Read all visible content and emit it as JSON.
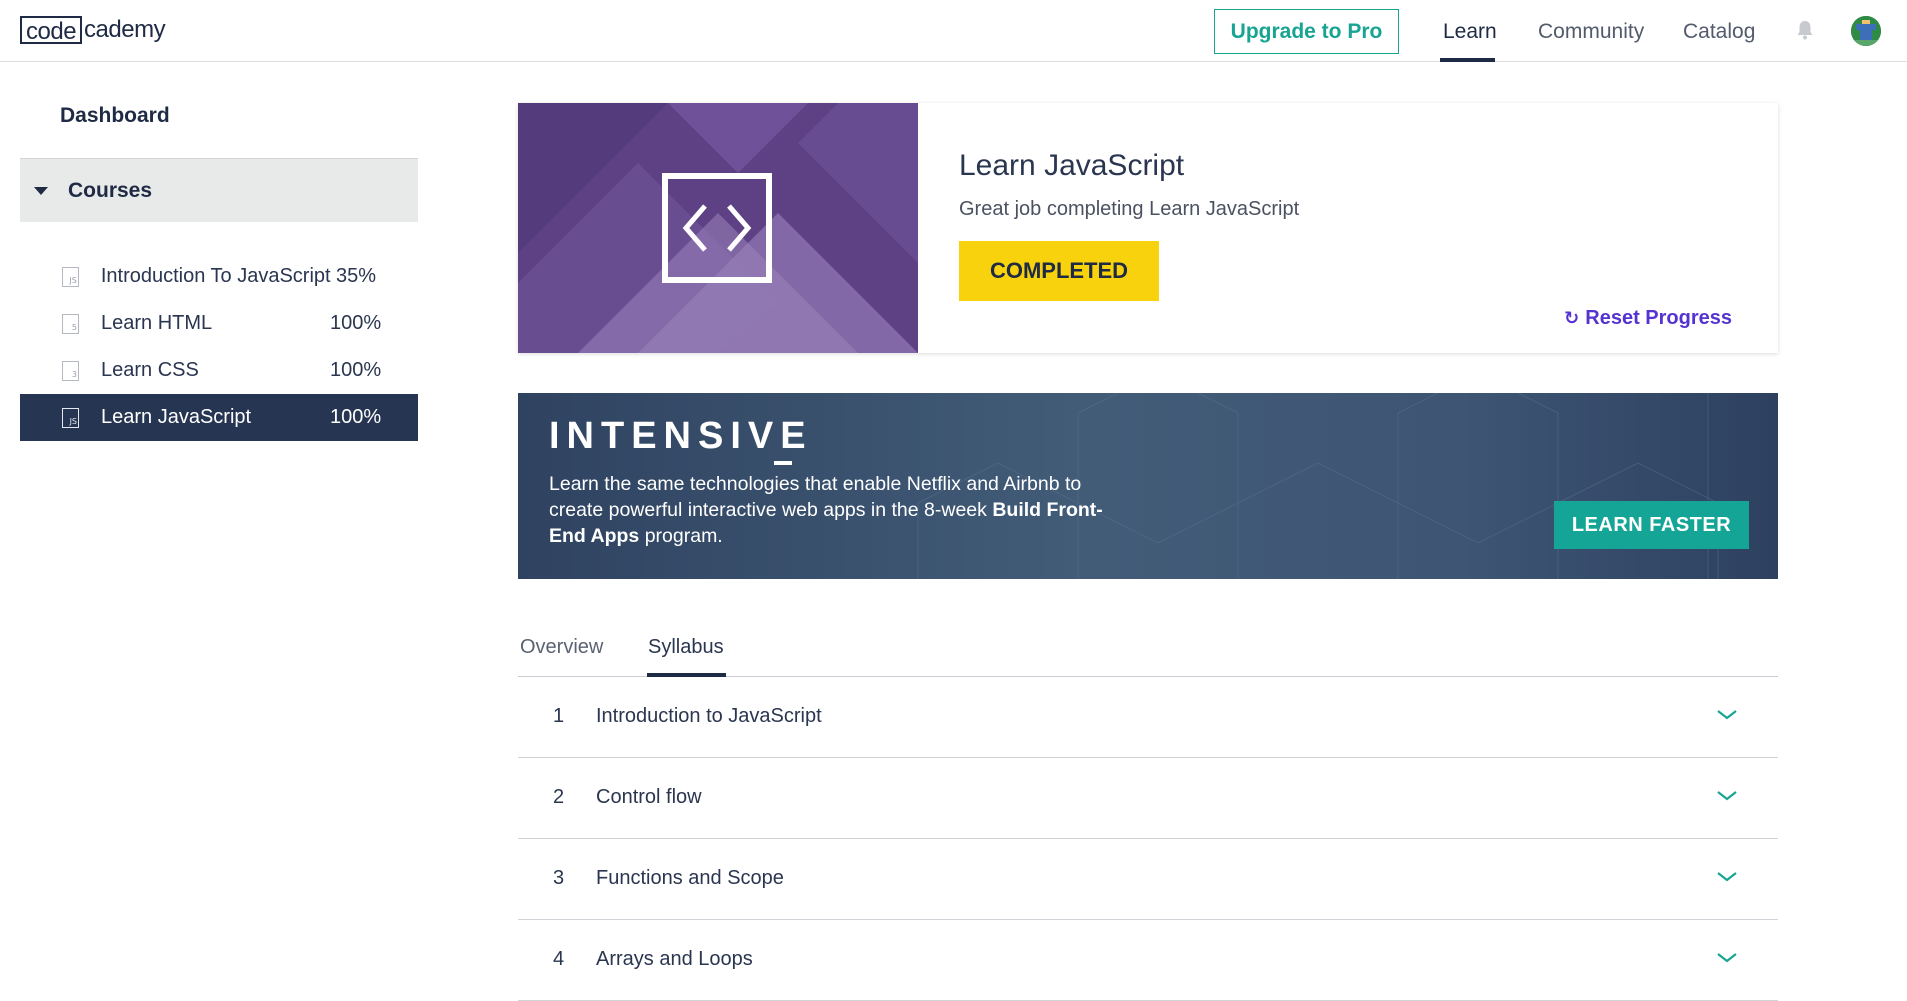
{
  "header": {
    "logo_left": "code",
    "logo_right": "cademy",
    "upgrade_label": "Upgrade to Pro",
    "nav": [
      {
        "label": "Learn",
        "active": true
      },
      {
        "label": "Community",
        "active": false
      },
      {
        "label": "Catalog",
        "active": false
      }
    ],
    "icons": {
      "bell": "bell-icon",
      "avatar": "avatar"
    }
  },
  "sidebar": {
    "dashboard_label": "Dashboard",
    "courses_label": "Courses",
    "courses": [
      {
        "name": "Introduction To JavaScript",
        "percent": "35%",
        "icon_text": "JS",
        "icon": "js-icon",
        "active": false
      },
      {
        "name": "Learn HTML",
        "percent": "100%",
        "icon_text": "5",
        "icon": "html5-icon",
        "active": false
      },
      {
        "name": "Learn CSS",
        "percent": "100%",
        "icon_text": "3",
        "icon": "css3-icon",
        "active": false
      },
      {
        "name": "Learn JavaScript",
        "percent": "100%",
        "icon_text": "JS",
        "icon": "js-icon",
        "active": true
      }
    ]
  },
  "course_card": {
    "title": "Learn JavaScript",
    "subtitle": "Great job completing Learn JavaScript",
    "status_label": "COMPLETED",
    "reset_label": "Reset Progress",
    "art_icon": "code-brackets-icon"
  },
  "banner": {
    "title": "INTENSIVE",
    "text_1": "Learn the same technologies that enable Netflix and Airbnb to create powerful interactive web apps in the 8-week ",
    "text_bold": "Build Front-End Apps",
    "text_2": " program.",
    "button_label": "LEARN FASTER"
  },
  "tabs": [
    {
      "label": "Overview",
      "active": false
    },
    {
      "label": "Syllabus",
      "active": true
    }
  ],
  "syllabus": [
    {
      "num": "1",
      "title": "Introduction to JavaScript"
    },
    {
      "num": "2",
      "title": "Control flow"
    },
    {
      "num": "3",
      "title": "Functions and Scope"
    },
    {
      "num": "4",
      "title": "Arrays and Loops"
    }
  ],
  "colors": {
    "brand_navy": "#1f2a44",
    "accent_teal": "#17a493",
    "completed_yellow": "#f8d30d",
    "reset_purple": "#5533d1",
    "card_purple": "#5b3f82"
  }
}
